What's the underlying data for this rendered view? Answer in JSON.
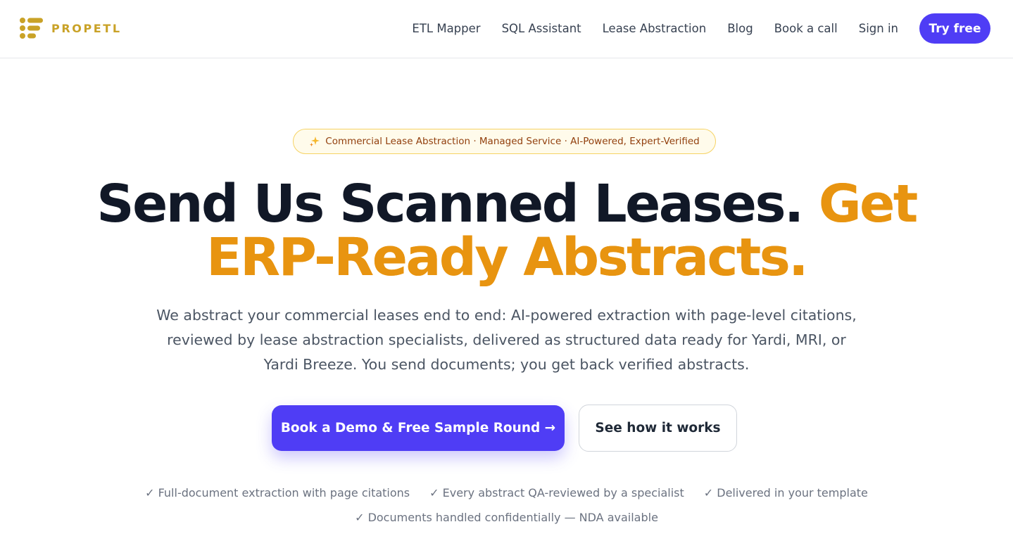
{
  "header": {
    "logo_text": "PROPETL",
    "logo_color": "#c9a227",
    "nav": [
      {
        "label": "ETL Mapper"
      },
      {
        "label": "SQL Assistant"
      },
      {
        "label": "Lease Abstraction"
      },
      {
        "label": "Blog"
      },
      {
        "label": "Book a call"
      },
      {
        "label": "Sign in"
      }
    ],
    "cta_label": "Try free"
  },
  "hero": {
    "badge_icon": "sparkles-icon",
    "badge_text": "Commercial Lease Abstraction · Managed Service · AI-Powered, Expert-Verified",
    "headline_part1": "Send Us Scanned Leases.",
    "headline_accent_line1": "Get",
    "headline_accent_line2": "ERP-Ready Abstracts.",
    "description": "We abstract your commercial leases end to end: AI-powered extraction with page-level citations, reviewed by lease abstraction specialists, delivered as structured data ready for Yardi, MRI, or Yardi Breeze. You send documents; you get back verified abstracts.",
    "primary_cta": "Book a Demo & Free Sample Round →",
    "secondary_cta": "See how it works",
    "features": [
      "✓ Full-document extraction with page citations",
      "✓ Every abstract QA-reviewed by a specialist",
      "✓ Delivered in your template",
      "✓ Documents handled confidentially — NDA available"
    ]
  },
  "colors": {
    "primary": "#4f3df5",
    "accent": "#f59e0b",
    "heading": "#111827",
    "body_text": "#4b5563"
  }
}
